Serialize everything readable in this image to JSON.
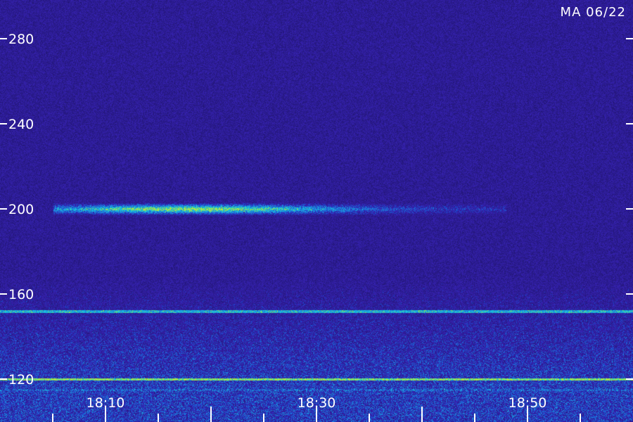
{
  "stamp": "MA 06/22",
  "colors": {
    "background": "#1d1478",
    "signal_low": "#2b3fd0",
    "signal_mid": "#1fa8d8",
    "signal_high": "#9cf07a",
    "text": "#ffffff"
  },
  "chart_data": {
    "type": "heatmap",
    "title": "",
    "xlabel": "",
    "ylabel": "",
    "y_ticks": [
      280,
      240,
      200,
      160,
      120
    ],
    "x_ticks": [
      "18:10",
      "18:30",
      "18:50"
    ],
    "x_tick_values_min": [
      10,
      30,
      50
    ],
    "xlim_min": [
      0,
      60
    ],
    "ylim": [
      110,
      290
    ],
    "x_minor_tick_step_min": 5,
    "features": [
      {
        "kind": "emission_band",
        "y": 200,
        "from_min": 5,
        "to_min": 48,
        "peak_min": 18,
        "intensity": "high"
      },
      {
        "kind": "continuous_line",
        "y": 152,
        "intensity": "mid"
      },
      {
        "kind": "continuous_line",
        "y": 120,
        "intensity": "high"
      },
      {
        "kind": "broadband_noise",
        "y_from": 110,
        "y_to": 170,
        "intensity": "mid"
      }
    ]
  }
}
